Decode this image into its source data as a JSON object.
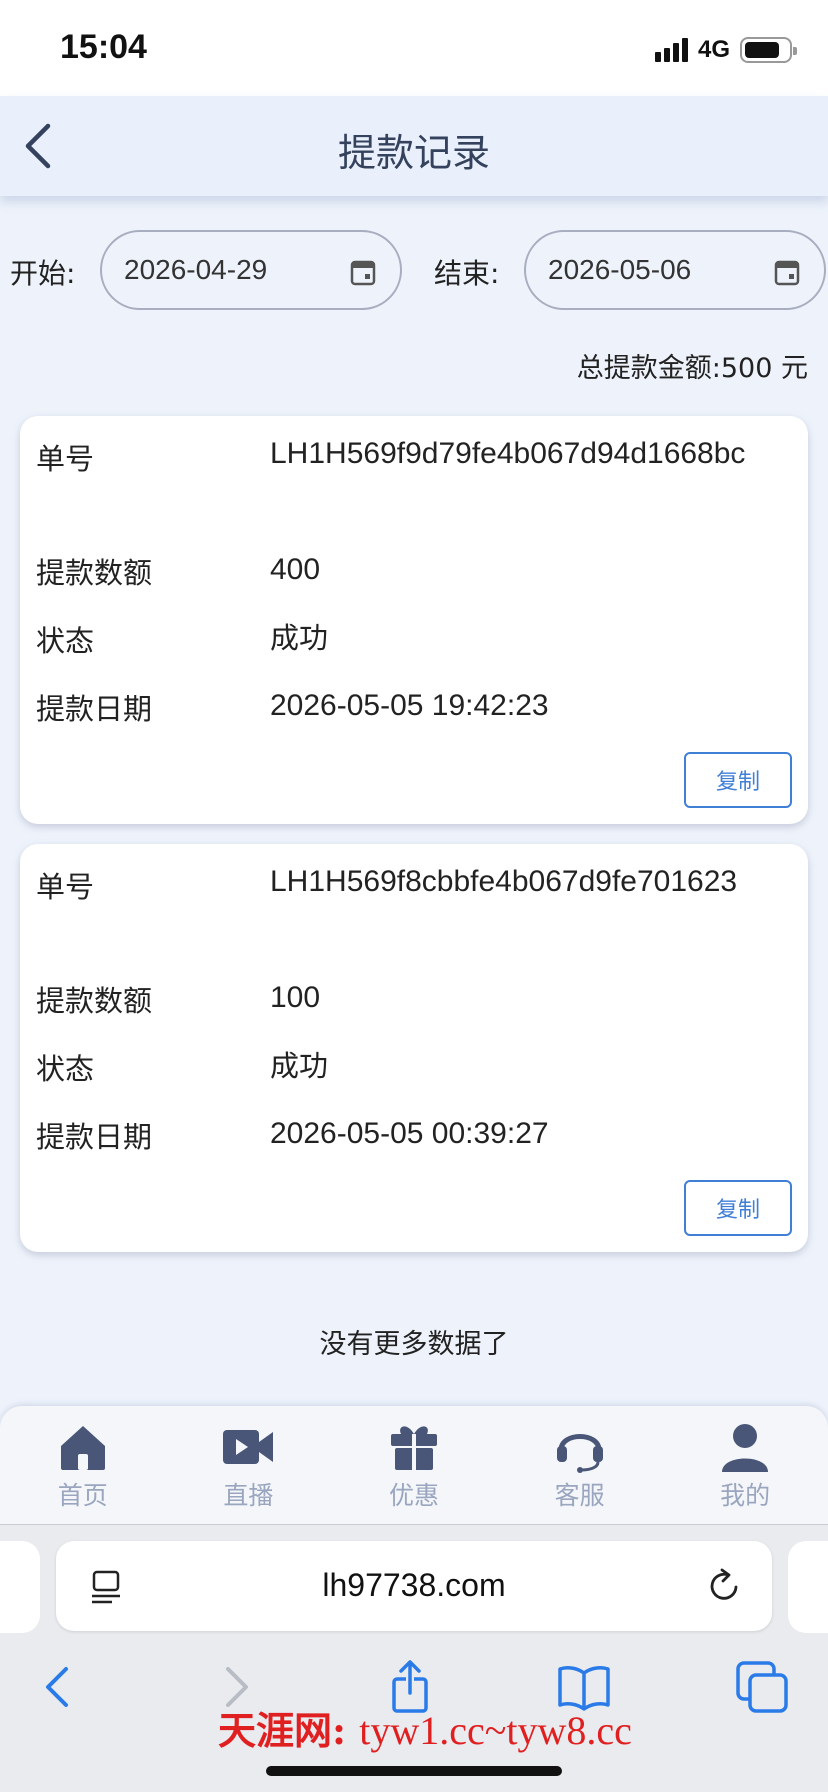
{
  "status_bar": {
    "time": "15:04",
    "network": "4G"
  },
  "header": {
    "title": "提款记录"
  },
  "filters": {
    "start_label": "开始:",
    "start_date": "2026-04-29",
    "end_label": "结束:",
    "end_date": "2026-05-06"
  },
  "summary": {
    "total_text": "总提款金额:500 元"
  },
  "labels": {
    "order_no": "单号",
    "amount": "提款数额",
    "status": "状态",
    "date": "提款日期",
    "copy": "复制"
  },
  "records": [
    {
      "order_no": "LH1H569f9d79fe4b067d94d1668bc",
      "amount": "400",
      "status": "成功",
      "date": "2026-05-05 19:42:23"
    },
    {
      "order_no": "LH1H569f8cbbfe4b067d9fe701623",
      "amount": "100",
      "status": "成功",
      "date": "2026-05-05 00:39:27"
    }
  ],
  "list_end_text": "没有更多数据了",
  "tab_bar": {
    "items": [
      {
        "label": "首页",
        "icon": "home-icon"
      },
      {
        "label": "直播",
        "icon": "video-camera-icon"
      },
      {
        "label": "优惠",
        "icon": "gift-icon"
      },
      {
        "label": "客服",
        "icon": "headset-icon"
      },
      {
        "label": "我的",
        "icon": "user-icon"
      }
    ]
  },
  "browser": {
    "url": "lh97738.com"
  },
  "watermark": {
    "prefix": "天涯网:",
    "sites": "tyw1.cc~tyw8.cc"
  },
  "colors": {
    "background": "#eef3fb",
    "accent": "#3f7fd6",
    "title": "#34425e",
    "tab_icon": "#4a5678",
    "tab_label": "#9aa6bf",
    "watermark": "#e02020"
  }
}
